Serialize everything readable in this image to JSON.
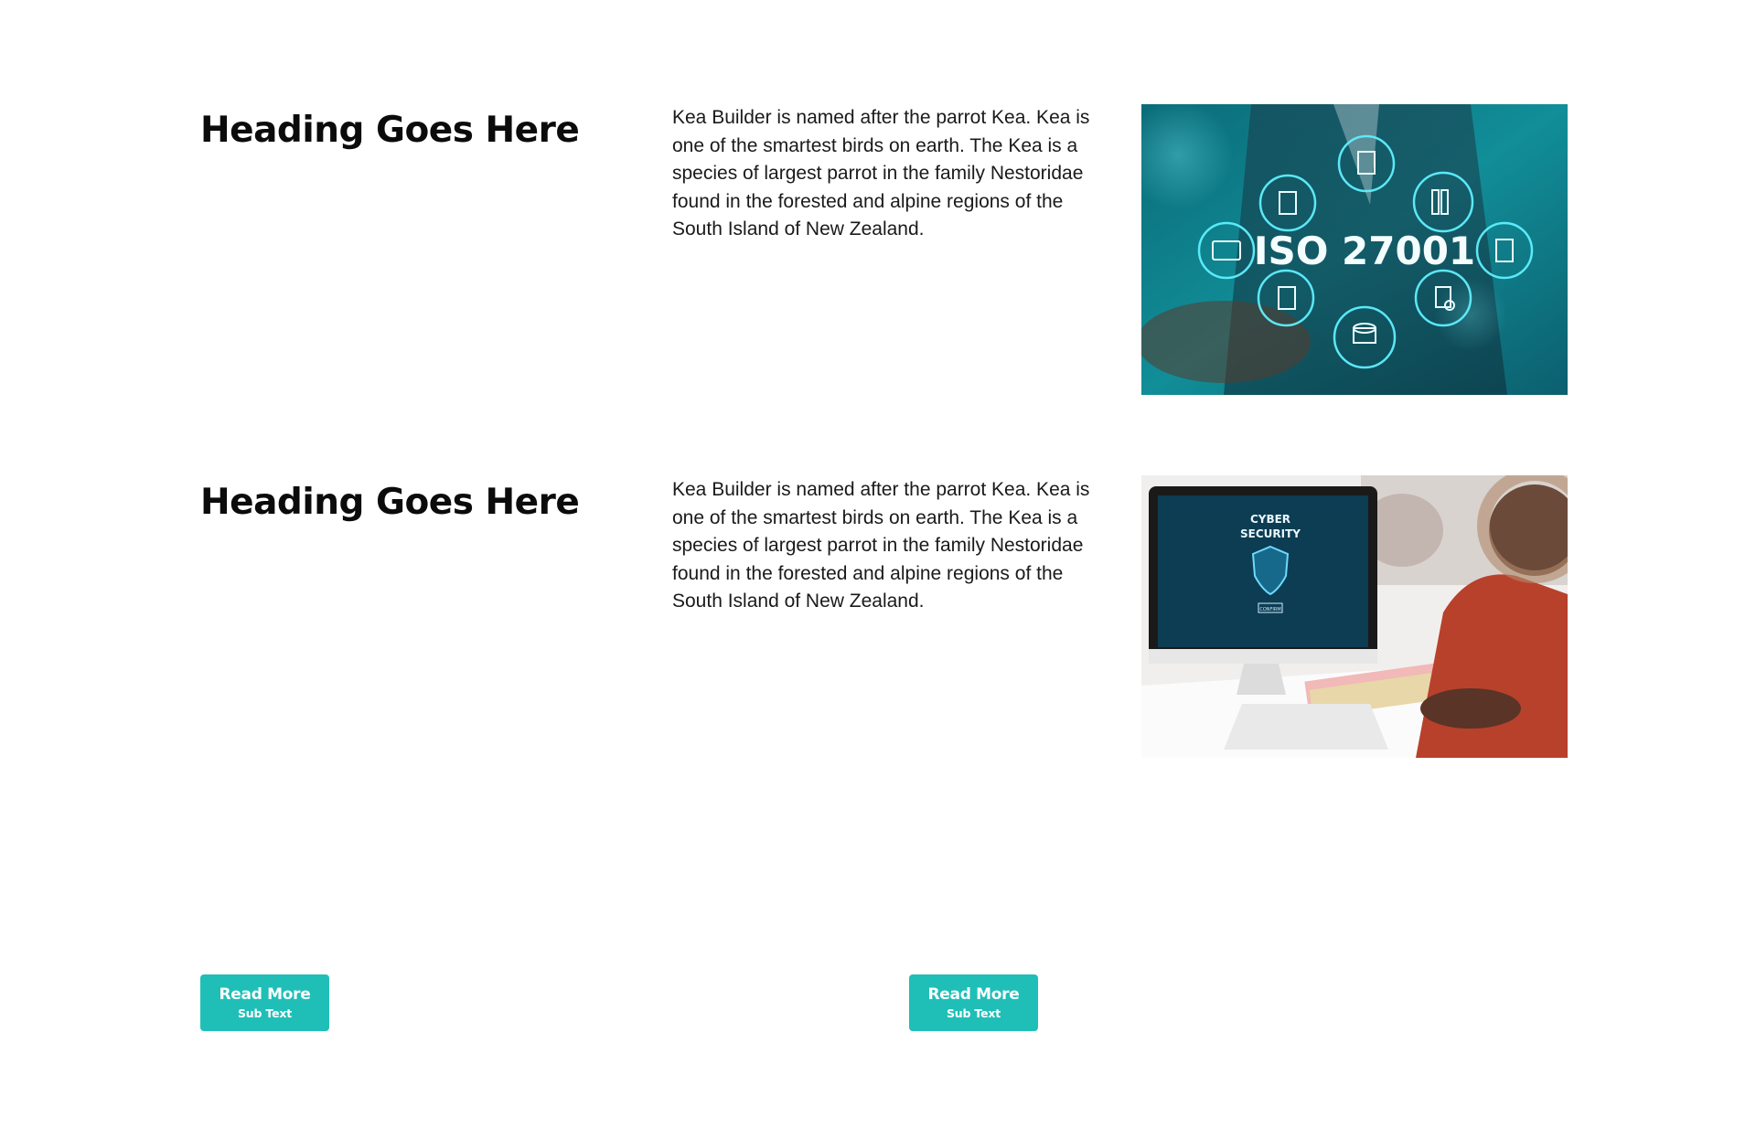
{
  "sections": [
    {
      "heading": "Heading Goes Here",
      "body": "Kea Builder is named after the parrot Kea. Kea is one of the smartest birds on earth. The Kea is a species of largest parrot in the family Nestoridae found in the forested and alpine regions of the South Island of New Zealand.",
      "image": {
        "label": "ISO 27001",
        "icons": [
          "id-card-icon",
          "document-icon",
          "gear-document-icon",
          "binders-icon",
          "edit-document-icon",
          "lock-document-icon",
          "database-icon",
          "search-document-icon"
        ]
      }
    },
    {
      "heading": "Heading Goes Here",
      "body": "Kea Builder is named after the parrot Kea. Kea is one of the smartest birds on earth. The Kea is a species of largest parrot in the family Nestoridae found in the forested and alpine regions of the South Island of New Zealand.",
      "image": {
        "screen_title_line1": "CYBER",
        "screen_title_line2": "SECURITY",
        "screen_button": "CONFIRM",
        "icons": [
          "shield-icon"
        ]
      }
    }
  ],
  "buttons": [
    {
      "label": "Read More",
      "sub": "Sub Text"
    },
    {
      "label": "Read More",
      "sub": "Sub Text"
    }
  ],
  "colors": {
    "accent": "#1fbfb8",
    "heading": "#0b0b0b",
    "text": "#1a1a1a",
    "image1_bg": "#0e7c86",
    "image1_glow": "#3fe0ea"
  }
}
